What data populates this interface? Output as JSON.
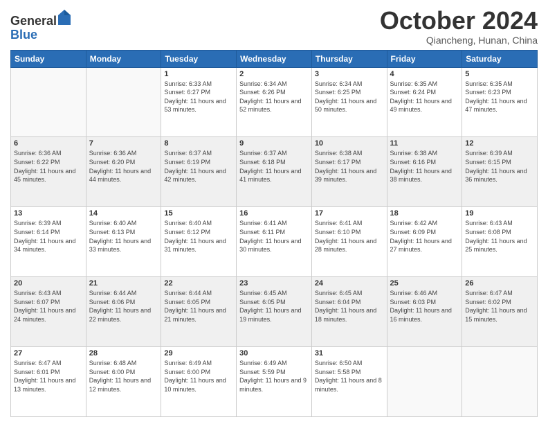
{
  "logo": {
    "general": "General",
    "blue": "Blue"
  },
  "header": {
    "month": "October 2024",
    "location": "Qiancheng, Hunan, China"
  },
  "weekdays": [
    "Sunday",
    "Monday",
    "Tuesday",
    "Wednesday",
    "Thursday",
    "Friday",
    "Saturday"
  ],
  "weeks": [
    [
      {
        "day": "",
        "sunrise": "",
        "sunset": "",
        "daylight": ""
      },
      {
        "day": "",
        "sunrise": "",
        "sunset": "",
        "daylight": ""
      },
      {
        "day": "1",
        "sunrise": "Sunrise: 6:33 AM",
        "sunset": "Sunset: 6:27 PM",
        "daylight": "Daylight: 11 hours and 53 minutes."
      },
      {
        "day": "2",
        "sunrise": "Sunrise: 6:34 AM",
        "sunset": "Sunset: 6:26 PM",
        "daylight": "Daylight: 11 hours and 52 minutes."
      },
      {
        "day": "3",
        "sunrise": "Sunrise: 6:34 AM",
        "sunset": "Sunset: 6:25 PM",
        "daylight": "Daylight: 11 hours and 50 minutes."
      },
      {
        "day": "4",
        "sunrise": "Sunrise: 6:35 AM",
        "sunset": "Sunset: 6:24 PM",
        "daylight": "Daylight: 11 hours and 49 minutes."
      },
      {
        "day": "5",
        "sunrise": "Sunrise: 6:35 AM",
        "sunset": "Sunset: 6:23 PM",
        "daylight": "Daylight: 11 hours and 47 minutes."
      }
    ],
    [
      {
        "day": "6",
        "sunrise": "Sunrise: 6:36 AM",
        "sunset": "Sunset: 6:22 PM",
        "daylight": "Daylight: 11 hours and 45 minutes."
      },
      {
        "day": "7",
        "sunrise": "Sunrise: 6:36 AM",
        "sunset": "Sunset: 6:20 PM",
        "daylight": "Daylight: 11 hours and 44 minutes."
      },
      {
        "day": "8",
        "sunrise": "Sunrise: 6:37 AM",
        "sunset": "Sunset: 6:19 PM",
        "daylight": "Daylight: 11 hours and 42 minutes."
      },
      {
        "day": "9",
        "sunrise": "Sunrise: 6:37 AM",
        "sunset": "Sunset: 6:18 PM",
        "daylight": "Daylight: 11 hours and 41 minutes."
      },
      {
        "day": "10",
        "sunrise": "Sunrise: 6:38 AM",
        "sunset": "Sunset: 6:17 PM",
        "daylight": "Daylight: 11 hours and 39 minutes."
      },
      {
        "day": "11",
        "sunrise": "Sunrise: 6:38 AM",
        "sunset": "Sunset: 6:16 PM",
        "daylight": "Daylight: 11 hours and 38 minutes."
      },
      {
        "day": "12",
        "sunrise": "Sunrise: 6:39 AM",
        "sunset": "Sunset: 6:15 PM",
        "daylight": "Daylight: 11 hours and 36 minutes."
      }
    ],
    [
      {
        "day": "13",
        "sunrise": "Sunrise: 6:39 AM",
        "sunset": "Sunset: 6:14 PM",
        "daylight": "Daylight: 11 hours and 34 minutes."
      },
      {
        "day": "14",
        "sunrise": "Sunrise: 6:40 AM",
        "sunset": "Sunset: 6:13 PM",
        "daylight": "Daylight: 11 hours and 33 minutes."
      },
      {
        "day": "15",
        "sunrise": "Sunrise: 6:40 AM",
        "sunset": "Sunset: 6:12 PM",
        "daylight": "Daylight: 11 hours and 31 minutes."
      },
      {
        "day": "16",
        "sunrise": "Sunrise: 6:41 AM",
        "sunset": "Sunset: 6:11 PM",
        "daylight": "Daylight: 11 hours and 30 minutes."
      },
      {
        "day": "17",
        "sunrise": "Sunrise: 6:41 AM",
        "sunset": "Sunset: 6:10 PM",
        "daylight": "Daylight: 11 hours and 28 minutes."
      },
      {
        "day": "18",
        "sunrise": "Sunrise: 6:42 AM",
        "sunset": "Sunset: 6:09 PM",
        "daylight": "Daylight: 11 hours and 27 minutes."
      },
      {
        "day": "19",
        "sunrise": "Sunrise: 6:43 AM",
        "sunset": "Sunset: 6:08 PM",
        "daylight": "Daylight: 11 hours and 25 minutes."
      }
    ],
    [
      {
        "day": "20",
        "sunrise": "Sunrise: 6:43 AM",
        "sunset": "Sunset: 6:07 PM",
        "daylight": "Daylight: 11 hours and 24 minutes."
      },
      {
        "day": "21",
        "sunrise": "Sunrise: 6:44 AM",
        "sunset": "Sunset: 6:06 PM",
        "daylight": "Daylight: 11 hours and 22 minutes."
      },
      {
        "day": "22",
        "sunrise": "Sunrise: 6:44 AM",
        "sunset": "Sunset: 6:05 PM",
        "daylight": "Daylight: 11 hours and 21 minutes."
      },
      {
        "day": "23",
        "sunrise": "Sunrise: 6:45 AM",
        "sunset": "Sunset: 6:05 PM",
        "daylight": "Daylight: 11 hours and 19 minutes."
      },
      {
        "day": "24",
        "sunrise": "Sunrise: 6:45 AM",
        "sunset": "Sunset: 6:04 PM",
        "daylight": "Daylight: 11 hours and 18 minutes."
      },
      {
        "day": "25",
        "sunrise": "Sunrise: 6:46 AM",
        "sunset": "Sunset: 6:03 PM",
        "daylight": "Daylight: 11 hours and 16 minutes."
      },
      {
        "day": "26",
        "sunrise": "Sunrise: 6:47 AM",
        "sunset": "Sunset: 6:02 PM",
        "daylight": "Daylight: 11 hours and 15 minutes."
      }
    ],
    [
      {
        "day": "27",
        "sunrise": "Sunrise: 6:47 AM",
        "sunset": "Sunset: 6:01 PM",
        "daylight": "Daylight: 11 hours and 13 minutes."
      },
      {
        "day": "28",
        "sunrise": "Sunrise: 6:48 AM",
        "sunset": "Sunset: 6:00 PM",
        "daylight": "Daylight: 11 hours and 12 minutes."
      },
      {
        "day": "29",
        "sunrise": "Sunrise: 6:49 AM",
        "sunset": "Sunset: 6:00 PM",
        "daylight": "Daylight: 11 hours and 10 minutes."
      },
      {
        "day": "30",
        "sunrise": "Sunrise: 6:49 AM",
        "sunset": "Sunset: 5:59 PM",
        "daylight": "Daylight: 11 hours and 9 minutes."
      },
      {
        "day": "31",
        "sunrise": "Sunrise: 6:50 AM",
        "sunset": "Sunset: 5:58 PM",
        "daylight": "Daylight: 11 hours and 8 minutes."
      },
      {
        "day": "",
        "sunrise": "",
        "sunset": "",
        "daylight": ""
      },
      {
        "day": "",
        "sunrise": "",
        "sunset": "",
        "daylight": ""
      }
    ]
  ]
}
